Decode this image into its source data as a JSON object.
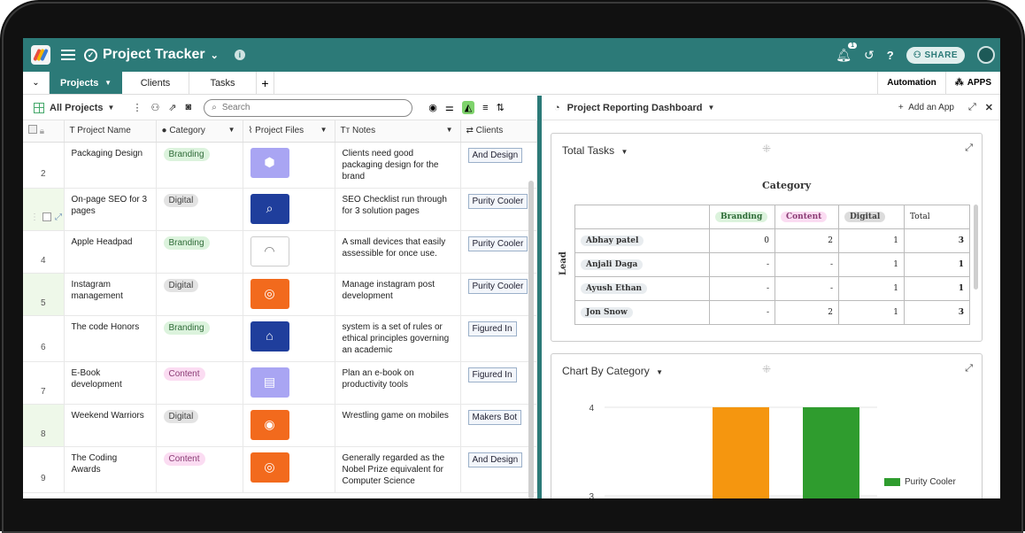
{
  "header": {
    "title": "Project Tracker",
    "notification_count": "1",
    "share_label": "SHARE"
  },
  "tabs": {
    "active": "Projects",
    "items": [
      "Clients",
      "Tasks"
    ],
    "automation_label": "Automation",
    "apps_label": "APPS"
  },
  "toolbar": {
    "view_name": "All Projects",
    "search_placeholder": "Search"
  },
  "columns": [
    "Project Name",
    "Category",
    "Project Files",
    "Notes",
    "Clients"
  ],
  "rows": [
    {
      "num": "2",
      "name": "Packaging Design",
      "category": "Branding",
      "file": "box",
      "notes": "Clients need good packaging design for the brand",
      "client": "And Design"
    },
    {
      "num": "",
      "name": "On-page SEO for 3 pages",
      "category": "Digital",
      "file": "seo",
      "notes": "SEO Checklist run through for 3 solution pages",
      "client": "Purity Cooler"
    },
    {
      "num": "4",
      "name": "Apple Headpad",
      "category": "Branding",
      "file": "headphones",
      "notes": "A small devices that easily assessible for once use.",
      "client": "Purity Cooler"
    },
    {
      "num": "5",
      "name": "Instagram management",
      "category": "Digital",
      "file": "instagram",
      "notes": "Manage instagram post development",
      "client": "Purity Cooler"
    },
    {
      "num": "6",
      "name": "The code Honors",
      "category": "Branding",
      "file": "presentation",
      "notes": "system is a set of rules or ethical principles governing an academic",
      "client": "Figured In"
    },
    {
      "num": "7",
      "name": "E-Book development",
      "category": "Content",
      "file": "ebook",
      "notes": "Plan an e-book on productivity tools",
      "client": "Figured In"
    },
    {
      "num": "8",
      "name": "Weekend Warriors",
      "category": "Digital",
      "file": "target",
      "notes": "Wrestling game on mobiles",
      "client": "Makers Bot"
    },
    {
      "num": "9",
      "name": "The Coding Awards",
      "category": "Content",
      "file": "instagram",
      "notes": "Generally regarded as the Nobel Prize equivalent for Computer Science",
      "client": "And Design"
    }
  ],
  "dashboard": {
    "title": "Project Reporting Dashboard",
    "add_app_label": "Add an App",
    "pivot_widget": {
      "title": "Total Tasks",
      "column_header": "Category",
      "row_header": "Lead",
      "columns": [
        "Branding",
        "Content",
        "Digital",
        "Total"
      ],
      "rows": [
        {
          "lead": "Abhay patel",
          "values": [
            "0",
            "2",
            "1",
            "3"
          ]
        },
        {
          "lead": "Anjali Daga",
          "values": [
            "-",
            "-",
            "1",
            "1"
          ]
        },
        {
          "lead": "Ayush Ethan",
          "values": [
            "-",
            "-",
            "1",
            "1"
          ]
        },
        {
          "lead": "Jon Snow",
          "values": [
            "-",
            "2",
            "1",
            "3"
          ]
        }
      ]
    },
    "chart_widget": {
      "title": "Chart By Category",
      "legend_label": "Purity Cooler"
    }
  },
  "chart_data": {
    "type": "bar",
    "title": "Chart By Category",
    "series": [
      {
        "name": "",
        "color": "#f5960f",
        "values": [
          4
        ]
      },
      {
        "name": "",
        "color": "#2f9c2e",
        "values": [
          4
        ]
      }
    ],
    "legend": [
      "Purity Cooler"
    ],
    "yticks": [
      3,
      4
    ],
    "ylim_visible": [
      2.6,
      4.1
    ]
  }
}
